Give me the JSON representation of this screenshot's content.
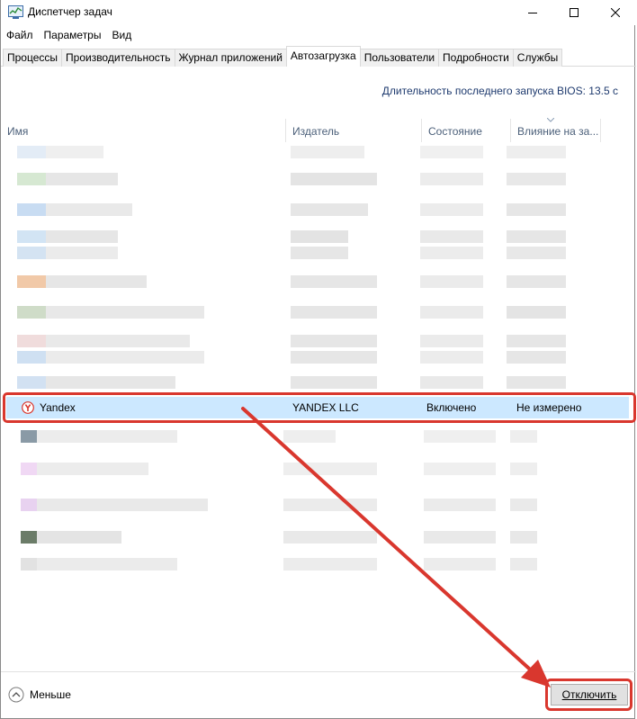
{
  "window": {
    "title": "Диспетчер задач",
    "icon": "task-manager-icon"
  },
  "menu": [
    "Файл",
    "Параметры",
    "Вид"
  ],
  "tabs": [
    {
      "label": "Процессы",
      "active": false
    },
    {
      "label": "Производительность",
      "active": false
    },
    {
      "label": "Журнал приложений",
      "active": false
    },
    {
      "label": "Автозагрузка",
      "active": true
    },
    {
      "label": "Пользователи",
      "active": false
    },
    {
      "label": "Подробности",
      "active": false
    },
    {
      "label": "Службы",
      "active": false
    }
  ],
  "bios_label": "Длительность последнего запуска BIOS: 13.5 с",
  "columns": {
    "name": "Имя",
    "publisher": "Издатель",
    "status": "Состояние",
    "impact": "Влияние на за..."
  },
  "selected_row": {
    "name": "Yandex",
    "publisher": "YANDEX LLC",
    "status": "Включено",
    "impact": "Не измерено",
    "icon": "yandex-browser-icon"
  },
  "footer": {
    "less_label": "Меньше",
    "less_icon": "chevron-up-circle-icon",
    "disable_label": "Отключить"
  },
  "colors": {
    "selection": "#cce8ff",
    "annotation": "#d9372e"
  }
}
